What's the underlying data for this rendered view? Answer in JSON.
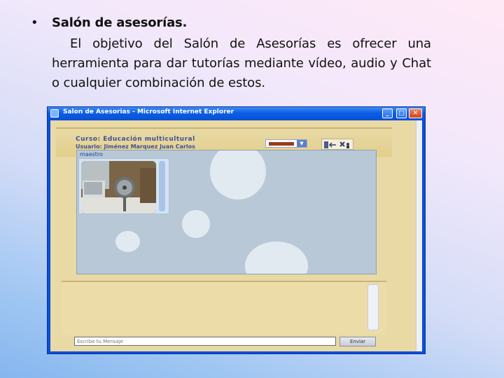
{
  "slide": {
    "bullet": "•",
    "heading": "Salón de asesorías.",
    "paragraph": "El objetivo del Salón de Asesorías es ofrecer una herramienta para dar tutorías mediante vídeo, audio y Chat o cualquier combinación de estos."
  },
  "window": {
    "title": "Salon de Asesorias - Microsoft Internet Explorer",
    "buttons": {
      "minimize": "_",
      "maximize": "□",
      "close": "✕"
    }
  },
  "app": {
    "course": "Curso: Educación multicultural",
    "user": "Usuario: Jiménez Marquez Juan Carlos",
    "teacher_label": "maestro",
    "message_placeholder": "Escribe tu Mensaje",
    "send_label": "Enviar"
  },
  "colors": {
    "accent": "#0b5ee4",
    "panel": "#b9c8d6",
    "background": "#e8d9a5"
  }
}
